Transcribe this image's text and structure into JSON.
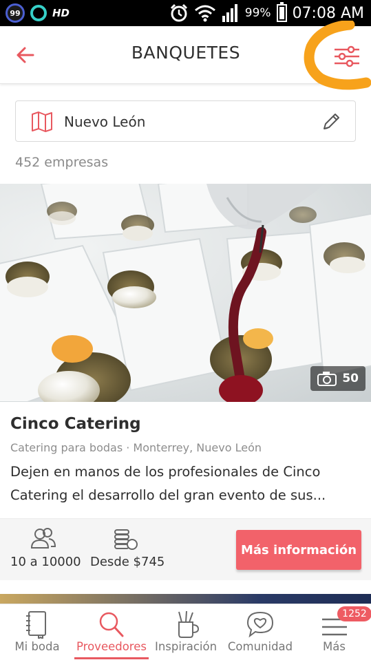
{
  "status_bar": {
    "badge_number": "99",
    "hd_label": "HD",
    "battery_percent": "99%",
    "time": "07:08 AM"
  },
  "header": {
    "title": "BANQUETES",
    "back_icon": "arrow-left-icon",
    "filter_icon": "sliders-icon"
  },
  "location": {
    "value": "Nuevo León",
    "map_icon": "map-icon",
    "edit_icon": "pencil-icon"
  },
  "results": {
    "count_text": "452 empresas"
  },
  "vendor": {
    "photo_count": "50",
    "name": "Cinco Catering",
    "meta": "Catering para bodas · Monterrey, Nuevo León",
    "description": "Dejen en manos de los profesionales de Cinco Catering el desarrollo del gran evento de sus...",
    "guests": "10 a 10000",
    "price": "Desde $745",
    "cta_label": "Más información"
  },
  "bottom_nav": {
    "items": [
      {
        "label": "Mi boda",
        "icon": "notebook-icon",
        "active": false
      },
      {
        "label": "Proveedores",
        "icon": "search-icon",
        "active": true
      },
      {
        "label": "Inspiración",
        "icon": "brush-cup-icon",
        "active": false
      },
      {
        "label": "Comunidad",
        "icon": "chat-heart-icon",
        "active": false
      },
      {
        "label": "Más",
        "icon": "menu-icon",
        "active": false,
        "badge": "1252"
      }
    ]
  },
  "colors": {
    "accent": "#E8585F",
    "button": "#F2626A",
    "annotation": "#F7A21B"
  }
}
